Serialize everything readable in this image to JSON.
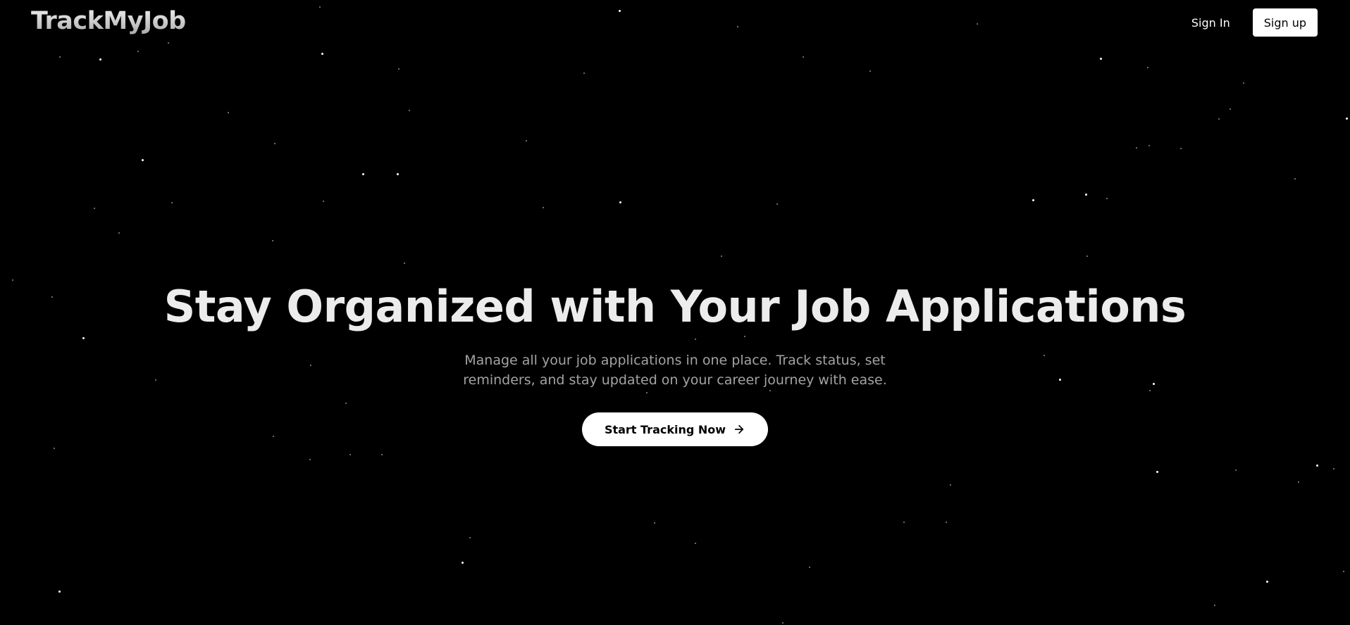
{
  "brand": {
    "logo_text": "TrackMyJob"
  },
  "nav": {
    "sign_in_label": "Sign In",
    "sign_up_label": "Sign up"
  },
  "hero": {
    "headline": "Stay Organized with Your Job Applications",
    "subtext": "Manage all your job applications in one place. Track status, set reminders, and stay updated on your career journey with ease.",
    "cta_label": "Start Tracking Now",
    "cta_icon": "arrow-right-icon"
  },
  "theme": {
    "background": "#000000",
    "text": "#ececec",
    "muted_text": "#a3a3a3",
    "button_bg": "#ffffff",
    "button_text": "#000000"
  }
}
